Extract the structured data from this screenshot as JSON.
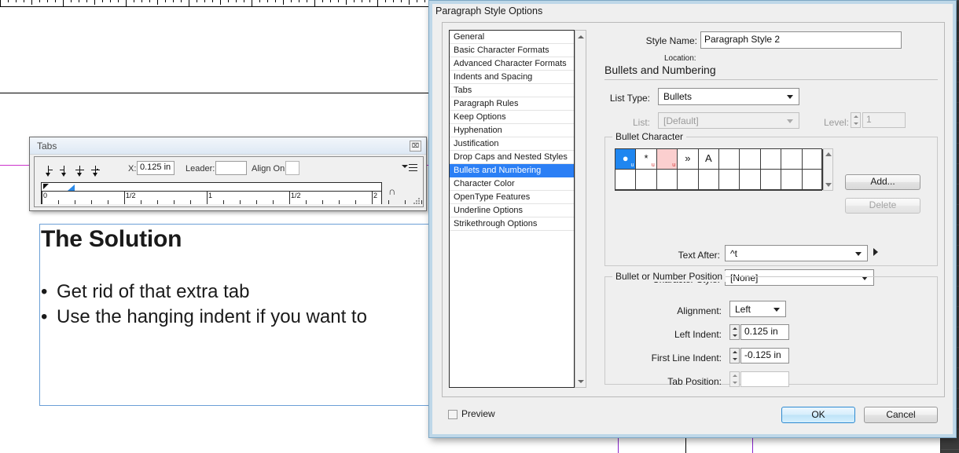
{
  "document": {
    "title": "The Solution",
    "bullets": [
      "Get rid of that extra tab",
      "Use the hanging indent if you want to"
    ],
    "bullet_glyph": "•"
  },
  "tabs_panel": {
    "title": "Tabs",
    "close_icon": "⌧",
    "align_buttons": [
      "left-justified-tab",
      "center-justified-tab",
      "right-justified-tab",
      "align-to-decimal-tab"
    ],
    "x_label": "X:",
    "x_value": "0.125 in",
    "leader_label": "Leader:",
    "leader_value": "",
    "align_on_label": "Align On:",
    "align_on_value": "",
    "ruler_labels": [
      "0",
      "1/2",
      "1",
      "1/2",
      "2"
    ],
    "magnet_icon": "∩"
  },
  "dialog": {
    "title": "Paragraph Style Options",
    "categories": [
      "General",
      "Basic Character Formats",
      "Advanced Character Formats",
      "Indents and Spacing",
      "Tabs",
      "Paragraph Rules",
      "Keep Options",
      "Hyphenation",
      "Justification",
      "Drop Caps and Nested Styles",
      "Bullets and Numbering",
      "Character Color",
      "OpenType Features",
      "Underline Options",
      "Strikethrough Options"
    ],
    "selected_category": "Bullets and Numbering",
    "style_name_label": "Style Name:",
    "style_name_value": "Paragraph Style 2",
    "location_label": "Location:",
    "section_heading": "Bullets and Numbering",
    "list_type_label": "List Type:",
    "list_type_value": "Bullets",
    "list_label": "List:",
    "list_value": "[Default]",
    "level_label": "Level:",
    "level_value": "1",
    "bullet_character": {
      "group_label": "Bullet Character",
      "cells": [
        {
          "glyph": "●",
          "sub": "u",
          "state": "selected"
        },
        {
          "glyph": "*",
          "sub": "u",
          "state": "normal"
        },
        {
          "glyph": "",
          "sub": "u",
          "state": "missing"
        },
        {
          "glyph": "»",
          "sub": "",
          "state": "normal"
        },
        {
          "glyph": "A",
          "sub": "",
          "state": "normal"
        },
        {
          "glyph": "",
          "sub": "",
          "state": "empty"
        },
        {
          "glyph": "",
          "sub": "",
          "state": "empty"
        },
        {
          "glyph": "",
          "sub": "",
          "state": "empty"
        },
        {
          "glyph": "",
          "sub": "",
          "state": "empty"
        },
        {
          "glyph": "",
          "sub": "",
          "state": "empty"
        }
      ],
      "add_button": "Add...",
      "delete_button": "Delete"
    },
    "text_after_label": "Text After:",
    "text_after_value": "^t",
    "character_style_label": "Character Style:",
    "character_style_value": "[None]",
    "position": {
      "group_label": "Bullet or Number Position",
      "alignment_label": "Alignment:",
      "alignment_value": "Left",
      "left_indent_label": "Left Indent:",
      "left_indent_value": "0.125 in",
      "first_line_indent_label": "First Line Indent:",
      "first_line_indent_value": "-0.125 in",
      "tab_position_label": "Tab Position:",
      "tab_position_value": ""
    },
    "preview_label": "Preview",
    "ok_label": "OK",
    "cancel_label": "Cancel"
  },
  "colors": {
    "selection_blue": "#2b7ff5",
    "guide_magenta": "#cc33cc",
    "guide_purple": "#8822cc",
    "missing_font_pink": "#fbcfcf",
    "frame_blue": "#6b9fd6"
  }
}
